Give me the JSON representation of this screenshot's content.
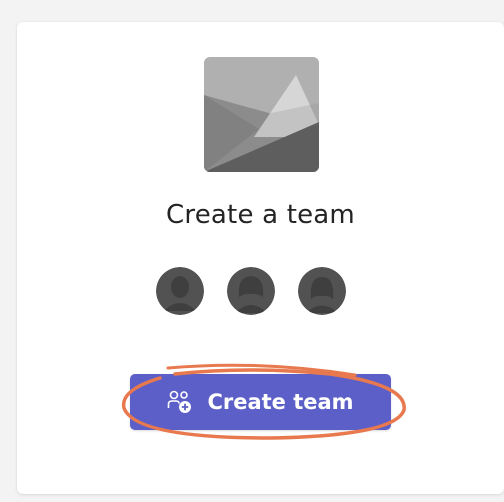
{
  "card": {
    "title": "Create a team",
    "thumbnail_icon": "image-placeholder-icon",
    "avatar_icons": [
      "person-icon",
      "person-icon",
      "person-icon"
    ],
    "button": {
      "label": "Create team",
      "icon": "people-add-icon"
    }
  },
  "colors": {
    "button_bg": "#5b5fc7",
    "annotation": "#e8794f",
    "avatar": "#525252"
  }
}
